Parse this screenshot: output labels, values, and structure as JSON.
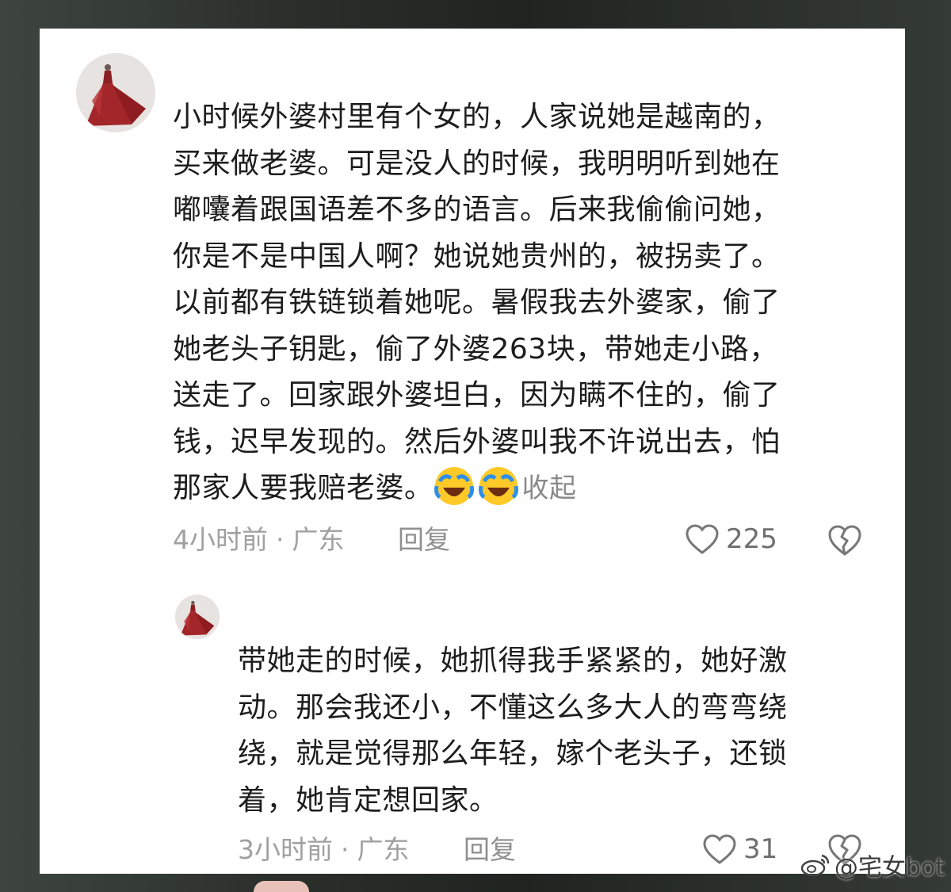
{
  "main_comment": {
    "lines": [
      "小时候外婆村里有个女的，人家说她是越南的，",
      "买来做老婆。可是没人的时候，我明明听到她在",
      "嘟囔着跟国语差不多的语言。后来我偷偷问她，",
      "你是不是中国人啊？她说她贵州的，被拐卖了。",
      "以前都有铁链锁着她呢。暑假我去外婆家，偷了",
      "她老头子钥匙，偷了外婆263块，带她走小路，",
      "送走了。回家跟外婆坦白，因为瞒不住的，偷了",
      "钱，迟早发现的。然后外婆叫我不许说出去，怕",
      "那家人要我赔老婆。"
    ],
    "collapse_label": "收起",
    "emoji": "laughing-crying-emoji",
    "time": "4小时前",
    "location": "广东",
    "separator": "·",
    "reply_label": "回复",
    "likes": "225"
  },
  "reply_comment": {
    "lines": [
      "带她走的时候，她抓得我手紧紧的，她好激",
      "动。那会我还小，不懂这么多大人的弯弯绕",
      "绕，就是觉得那么年轻，嫁个老头子，还锁",
      "着，她肯定想回家。"
    ],
    "time": "3小时前",
    "location": "广东",
    "separator": "·",
    "reply_label": "回复",
    "likes": "31"
  },
  "watermark": {
    "text": "@宅女bot",
    "icon": "weibo-icon"
  },
  "colors": {
    "card_bg": "#ffffff",
    "text": "#1d1d1d",
    "meta": "#a0a0a0",
    "backdrop": "#2f3432"
  }
}
